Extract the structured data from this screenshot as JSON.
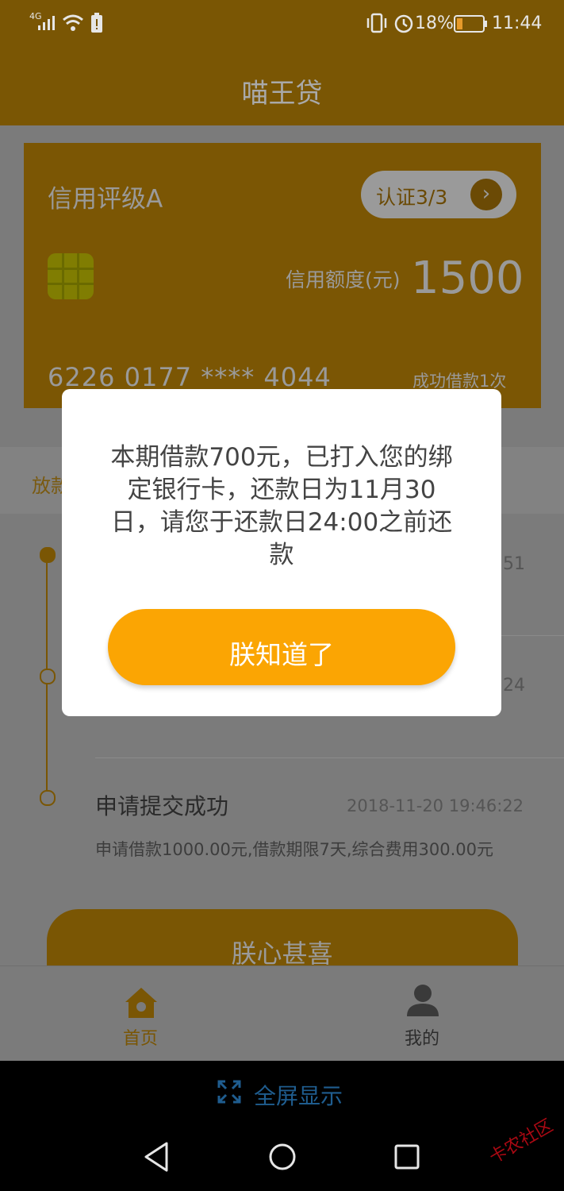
{
  "status_bar": {
    "network": "4G",
    "battery": "18%",
    "time": "11:44"
  },
  "header": {
    "title": "喵王贷"
  },
  "card": {
    "rating": "信用评级A",
    "certification": "认证3/3",
    "limit_label": "信用额度(元)",
    "limit_value": "1500",
    "card_number": "6226 0177 **** 4044",
    "success_count": "成功借款1次"
  },
  "section": {
    "label_partial": "放款"
  },
  "timeline": {
    "item1_time_partial": "51",
    "item2_time_partial": "24",
    "item3": {
      "title": "申请提交成功",
      "time": "2018-11-20 19:46:22",
      "desc": "申请借款1000.00元,借款期限7天,综合费用300.00元"
    }
  },
  "cta": {
    "label": "朕心甚喜"
  },
  "tabs": [
    {
      "label": "首页",
      "icon": "home-icon",
      "active": true
    },
    {
      "label": "我的",
      "icon": "user-icon",
      "active": false
    }
  ],
  "system_nav": {
    "fullscreen_label": "全屏显示"
  },
  "dialog": {
    "message": "本期借款700元，已打入您的绑定银行卡，还款日为11月30日，请您于还款日24:00之前还款",
    "button_label": "朕知道了"
  },
  "watermark": "卡农社区",
  "colors": {
    "accent": "#fba503",
    "header_dim": "#7a5604"
  }
}
